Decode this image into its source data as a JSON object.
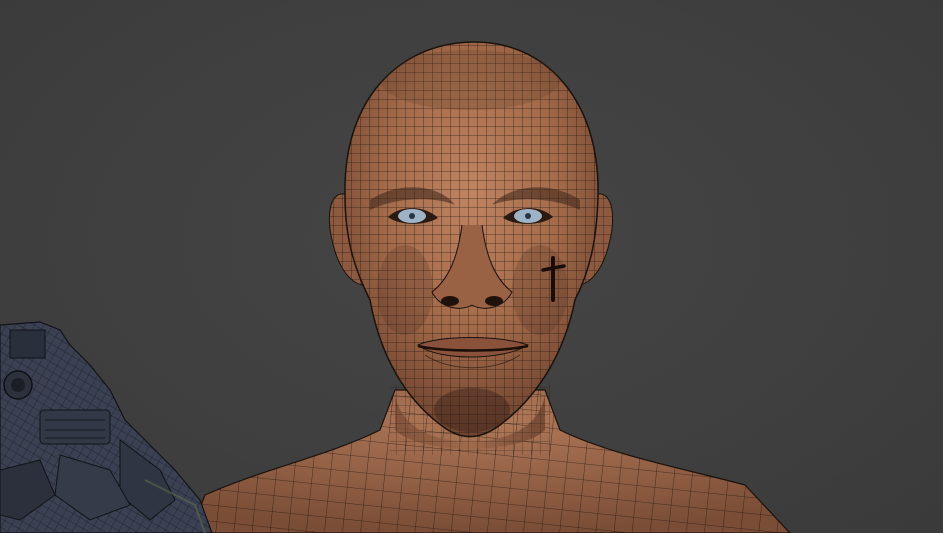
{
  "viewport": {
    "background": "#404040",
    "subject": "wireframe-head-model",
    "skin_color": "#a9714f",
    "wire_color": "#1a120d",
    "eye_color": "#9fb3c6",
    "weapon_color": "#3b4152"
  }
}
